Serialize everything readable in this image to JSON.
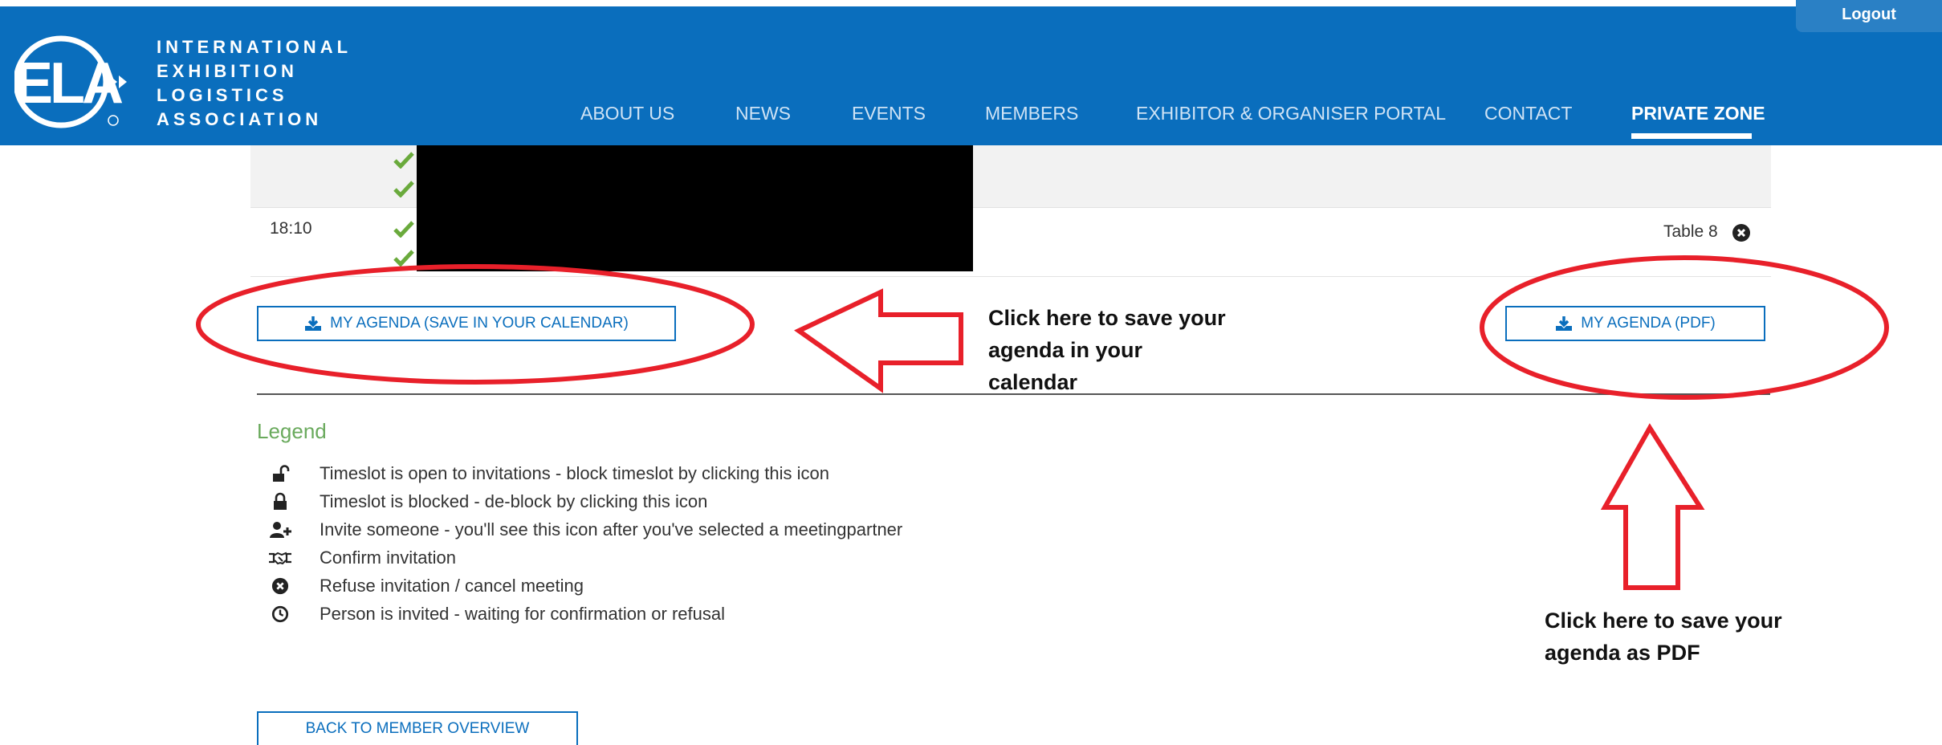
{
  "header": {
    "logo_lines": [
      "INTERNATIONAL",
      "EXHIBITION",
      "LOGISTICS",
      "ASSOCIATION"
    ],
    "logo_mark_text": "IELA",
    "logout": "Logout",
    "nav": [
      {
        "label": "ABOUT US"
      },
      {
        "label": "NEWS"
      },
      {
        "label": "EVENTS"
      },
      {
        "label": "MEMBERS"
      },
      {
        "label": "EXHIBITOR & ORGANISER PORTAL"
      },
      {
        "label": "CONTACT"
      },
      {
        "label": "PRIVATE ZONE",
        "active": true
      }
    ]
  },
  "agenda": {
    "rows": [
      {
        "time": "",
        "checks": 2
      },
      {
        "time": "18:10",
        "checks": 2,
        "table": "Table 8"
      }
    ]
  },
  "buttons": {
    "calendar": "MY AGENDA (SAVE IN YOUR CALENDAR)",
    "pdf": "MY AGENDA (PDF)",
    "back": "BACK TO MEMBER OVERVIEW"
  },
  "legend": {
    "title": "Legend",
    "items": [
      {
        "icon": "unlock-icon",
        "text": "Timeslot is open to invitations - block timeslot by clicking this icon"
      },
      {
        "icon": "lock-icon",
        "text": "Timeslot is blocked - de-block by clicking this icon"
      },
      {
        "icon": "user-plus-icon",
        "text": "Invite someone - you'll see this icon after you've selected a meetingpartner"
      },
      {
        "icon": "handshake-icon",
        "text": "Confirm invitation"
      },
      {
        "icon": "times-circle-icon",
        "text": "Refuse invitation / cancel meeting"
      },
      {
        "icon": "clock-icon",
        "text": "Person is invited - waiting for confirmation or refusal"
      }
    ]
  },
  "annotations": {
    "calendar_note": [
      "Click here to save your",
      "agenda in your",
      "calendar"
    ],
    "pdf_note": [
      "Click here to save your",
      "agenda as PDF"
    ],
    "annotation_color": "#e8202a"
  },
  "colors": {
    "brand_blue": "#0a6ebd",
    "check_green": "#6aaa3c",
    "legend_green": "#6aaa5d"
  }
}
